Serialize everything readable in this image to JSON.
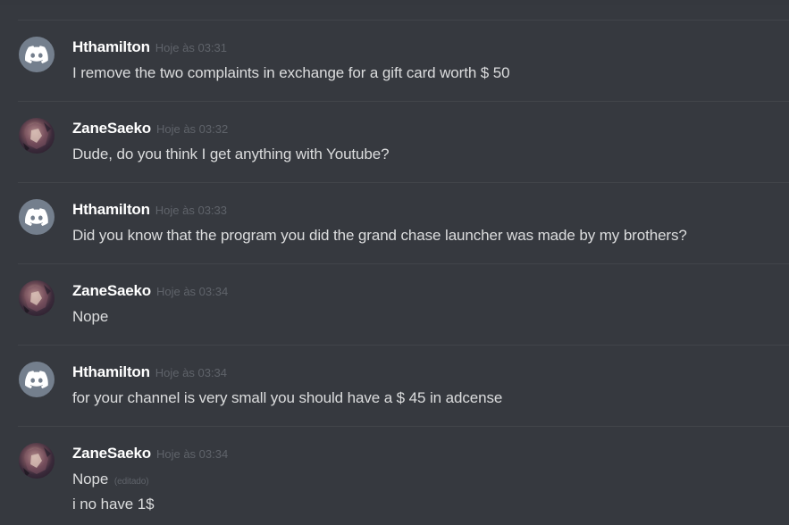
{
  "messages": [
    {
      "username": "Hthamilton",
      "avatar": "discord-logo-icon",
      "timestamp": "Hoje às 03:31",
      "lines": [
        "I remove the two complaints in exchange for a gift card worth $ 50"
      ]
    },
    {
      "username": "ZaneSaeko",
      "avatar": "anime-character-avatar",
      "timestamp": "Hoje às 03:32",
      "lines": [
        "Dude, do you think I get anything with Youtube?"
      ]
    },
    {
      "username": "Hthamilton",
      "avatar": "discord-logo-icon",
      "timestamp": "Hoje às 03:33",
      "lines": [
        "Did you know that the program you did the grand chase launcher was made by my brothers?"
      ]
    },
    {
      "username": "ZaneSaeko",
      "avatar": "anime-character-avatar",
      "timestamp": "Hoje às 03:34",
      "lines": [
        "Nope"
      ]
    },
    {
      "username": "Hthamilton",
      "avatar": "discord-logo-icon",
      "timestamp": "Hoje às 03:34",
      "lines": [
        "for your channel is very small you should have a $ 45 in adcense"
      ]
    },
    {
      "username": "ZaneSaeko",
      "avatar": "anime-character-avatar",
      "timestamp": "Hoje às 03:34",
      "lines": [
        "Nope",
        "i no have 1$"
      ],
      "edited_label": "(editado)"
    }
  ],
  "colors": {
    "background": "#36393f",
    "divider": "#42454a",
    "username": "#ffffff",
    "message_text": "#dcddde",
    "timestamp": "#5f636a",
    "discord_avatar_bg": "#747f8d"
  }
}
